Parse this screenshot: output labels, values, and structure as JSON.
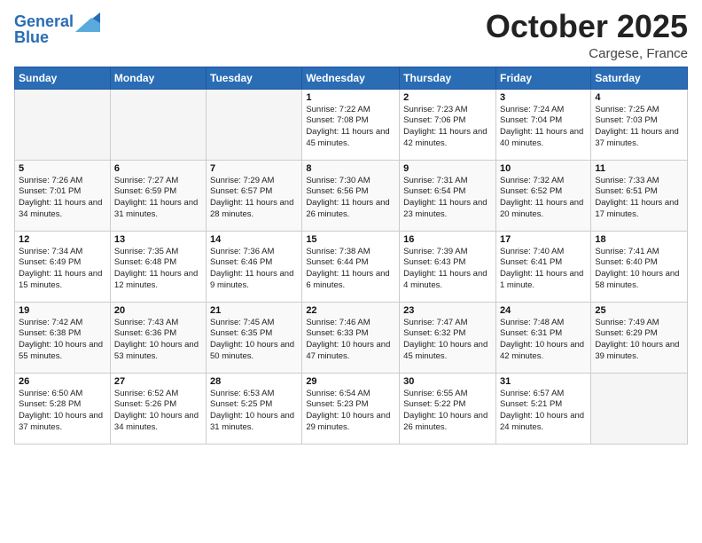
{
  "header": {
    "logo_line1": "General",
    "logo_line2": "Blue",
    "month": "October 2025",
    "location": "Cargese, France"
  },
  "weekdays": [
    "Sunday",
    "Monday",
    "Tuesday",
    "Wednesday",
    "Thursday",
    "Friday",
    "Saturday"
  ],
  "weeks": [
    [
      {
        "day": "",
        "info": ""
      },
      {
        "day": "",
        "info": ""
      },
      {
        "day": "",
        "info": ""
      },
      {
        "day": "1",
        "info": "Sunrise: 7:22 AM\nSunset: 7:08 PM\nDaylight: 11 hours and 45 minutes."
      },
      {
        "day": "2",
        "info": "Sunrise: 7:23 AM\nSunset: 7:06 PM\nDaylight: 11 hours and 42 minutes."
      },
      {
        "day": "3",
        "info": "Sunrise: 7:24 AM\nSunset: 7:04 PM\nDaylight: 11 hours and 40 minutes."
      },
      {
        "day": "4",
        "info": "Sunrise: 7:25 AM\nSunset: 7:03 PM\nDaylight: 11 hours and 37 minutes."
      }
    ],
    [
      {
        "day": "5",
        "info": "Sunrise: 7:26 AM\nSunset: 7:01 PM\nDaylight: 11 hours and 34 minutes."
      },
      {
        "day": "6",
        "info": "Sunrise: 7:27 AM\nSunset: 6:59 PM\nDaylight: 11 hours and 31 minutes."
      },
      {
        "day": "7",
        "info": "Sunrise: 7:29 AM\nSunset: 6:57 PM\nDaylight: 11 hours and 28 minutes."
      },
      {
        "day": "8",
        "info": "Sunrise: 7:30 AM\nSunset: 6:56 PM\nDaylight: 11 hours and 26 minutes."
      },
      {
        "day": "9",
        "info": "Sunrise: 7:31 AM\nSunset: 6:54 PM\nDaylight: 11 hours and 23 minutes."
      },
      {
        "day": "10",
        "info": "Sunrise: 7:32 AM\nSunset: 6:52 PM\nDaylight: 11 hours and 20 minutes."
      },
      {
        "day": "11",
        "info": "Sunrise: 7:33 AM\nSunset: 6:51 PM\nDaylight: 11 hours and 17 minutes."
      }
    ],
    [
      {
        "day": "12",
        "info": "Sunrise: 7:34 AM\nSunset: 6:49 PM\nDaylight: 11 hours and 15 minutes."
      },
      {
        "day": "13",
        "info": "Sunrise: 7:35 AM\nSunset: 6:48 PM\nDaylight: 11 hours and 12 minutes."
      },
      {
        "day": "14",
        "info": "Sunrise: 7:36 AM\nSunset: 6:46 PM\nDaylight: 11 hours and 9 minutes."
      },
      {
        "day": "15",
        "info": "Sunrise: 7:38 AM\nSunset: 6:44 PM\nDaylight: 11 hours and 6 minutes."
      },
      {
        "day": "16",
        "info": "Sunrise: 7:39 AM\nSunset: 6:43 PM\nDaylight: 11 hours and 4 minutes."
      },
      {
        "day": "17",
        "info": "Sunrise: 7:40 AM\nSunset: 6:41 PM\nDaylight: 11 hours and 1 minute."
      },
      {
        "day": "18",
        "info": "Sunrise: 7:41 AM\nSunset: 6:40 PM\nDaylight: 10 hours and 58 minutes."
      }
    ],
    [
      {
        "day": "19",
        "info": "Sunrise: 7:42 AM\nSunset: 6:38 PM\nDaylight: 10 hours and 55 minutes."
      },
      {
        "day": "20",
        "info": "Sunrise: 7:43 AM\nSunset: 6:36 PM\nDaylight: 10 hours and 53 minutes."
      },
      {
        "day": "21",
        "info": "Sunrise: 7:45 AM\nSunset: 6:35 PM\nDaylight: 10 hours and 50 minutes."
      },
      {
        "day": "22",
        "info": "Sunrise: 7:46 AM\nSunset: 6:33 PM\nDaylight: 10 hours and 47 minutes."
      },
      {
        "day": "23",
        "info": "Sunrise: 7:47 AM\nSunset: 6:32 PM\nDaylight: 10 hours and 45 minutes."
      },
      {
        "day": "24",
        "info": "Sunrise: 7:48 AM\nSunset: 6:31 PM\nDaylight: 10 hours and 42 minutes."
      },
      {
        "day": "25",
        "info": "Sunrise: 7:49 AM\nSunset: 6:29 PM\nDaylight: 10 hours and 39 minutes."
      }
    ],
    [
      {
        "day": "26",
        "info": "Sunrise: 6:50 AM\nSunset: 5:28 PM\nDaylight: 10 hours and 37 minutes."
      },
      {
        "day": "27",
        "info": "Sunrise: 6:52 AM\nSunset: 5:26 PM\nDaylight: 10 hours and 34 minutes."
      },
      {
        "day": "28",
        "info": "Sunrise: 6:53 AM\nSunset: 5:25 PM\nDaylight: 10 hours and 31 minutes."
      },
      {
        "day": "29",
        "info": "Sunrise: 6:54 AM\nSunset: 5:23 PM\nDaylight: 10 hours and 29 minutes."
      },
      {
        "day": "30",
        "info": "Sunrise: 6:55 AM\nSunset: 5:22 PM\nDaylight: 10 hours and 26 minutes."
      },
      {
        "day": "31",
        "info": "Sunrise: 6:57 AM\nSunset: 5:21 PM\nDaylight: 10 hours and 24 minutes."
      },
      {
        "day": "",
        "info": ""
      }
    ]
  ]
}
